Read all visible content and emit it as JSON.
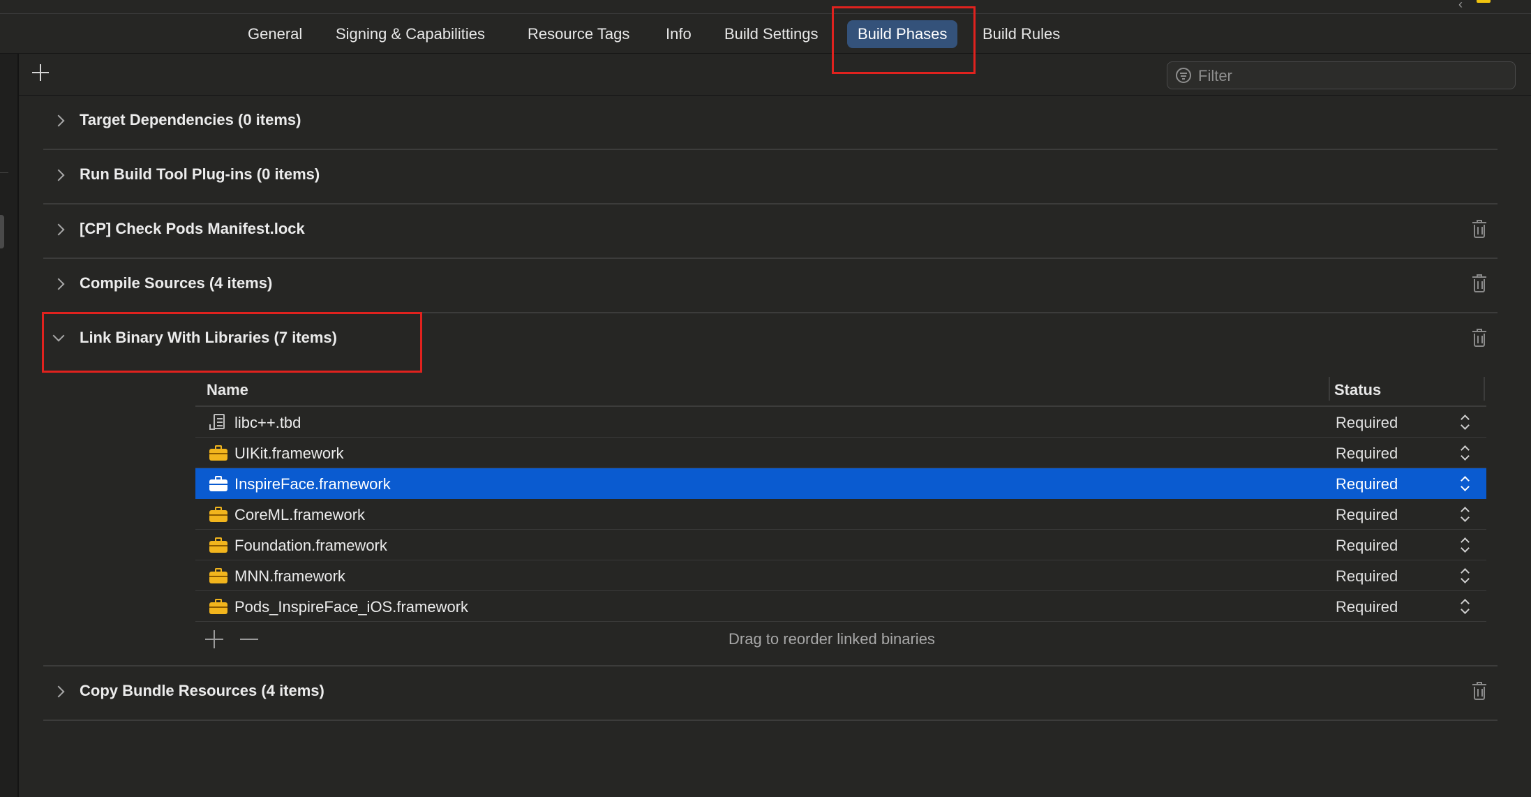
{
  "tabs": [
    {
      "label": "General"
    },
    {
      "label": "Signing & Capabilities"
    },
    {
      "label": "Resource Tags"
    },
    {
      "label": "Info"
    },
    {
      "label": "Build Settings"
    },
    {
      "label": "Build Phases",
      "active": true
    },
    {
      "label": "Build Rules"
    }
  ],
  "toolbar": {
    "filter_placeholder": "Filter"
  },
  "phases": [
    {
      "title": "Target Dependencies (0 items)",
      "expanded": false,
      "deletable": false
    },
    {
      "title": "Run Build Tool Plug-ins (0 items)",
      "expanded": false,
      "deletable": false
    },
    {
      "title": "[CP] Check Pods Manifest.lock",
      "expanded": false,
      "deletable": true
    },
    {
      "title": "Compile Sources (4 items)",
      "expanded": false,
      "deletable": true
    },
    {
      "title": "Link Binary With Libraries (7 items)",
      "expanded": true,
      "deletable": true
    },
    {
      "title": "Copy Bundle Resources (4 items)",
      "expanded": false,
      "deletable": true
    }
  ],
  "libraries": {
    "columns": {
      "name": "Name",
      "status": "Status"
    },
    "rows": [
      {
        "name": "libc++.tbd",
        "icon": "tbd-file-icon",
        "status": "Required",
        "selected": false
      },
      {
        "name": "UIKit.framework",
        "icon": "framework-icon",
        "status": "Required",
        "selected": false
      },
      {
        "name": "InspireFace.framework",
        "icon": "framework-icon",
        "status": "Required",
        "selected": true
      },
      {
        "name": "CoreML.framework",
        "icon": "framework-icon",
        "status": "Required",
        "selected": false
      },
      {
        "name": "Foundation.framework",
        "icon": "framework-icon",
        "status": "Required",
        "selected": false
      },
      {
        "name": "MNN.framework",
        "icon": "framework-icon",
        "status": "Required",
        "selected": false
      },
      {
        "name": "Pods_InspireFace_iOS.framework",
        "icon": "framework-icon",
        "status": "Required",
        "selected": false
      }
    ],
    "footer_hint": "Drag to reorder linked binaries"
  },
  "colors": {
    "background": "#262624",
    "active_tab": "#34527a",
    "selection": "#0a5bd0",
    "framework_icon": "#f2b51d",
    "annotation_box": "#e0221e"
  }
}
